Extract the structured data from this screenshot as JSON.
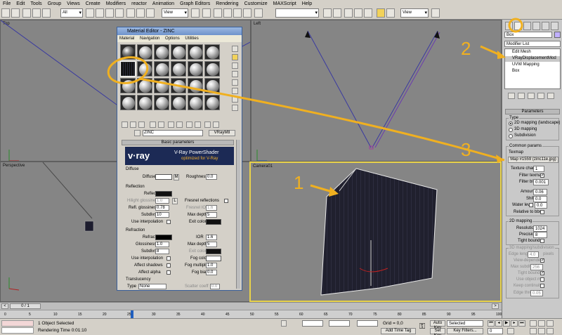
{
  "menu": [
    "File",
    "Edit",
    "Tools",
    "Group",
    "Views",
    "Create",
    "Modifiers",
    "reactor",
    "Animation",
    "Graph Editors",
    "Rendering",
    "Customize",
    "MAXScript",
    "Help"
  ],
  "toolbar": {
    "filter_value": "All",
    "ref_coord_value": "View",
    "selection_set_value": "",
    "view_value2": "View"
  },
  "viewports": {
    "top": "Top",
    "left": "Left",
    "perspective": "Perspective",
    "camera": "Camera01"
  },
  "material_editor": {
    "title": "Material Editor - ZINC",
    "menu": [
      "Material",
      "Navigation",
      "Options",
      "Utilities"
    ],
    "material_name": "ZINC",
    "material_type": "VRayMtl",
    "rollout_basic": "Basic parameters",
    "banner_title": "V-Ray PowerShader",
    "banner_subtitle": "optimized for V-Ray",
    "banner_logo": "v·ray",
    "diffuse_section": "Diffuse",
    "diffuse_label": "Diffuse",
    "diffuse_map_btn": "M",
    "roughness_label": "Roughness",
    "roughness_value": "0.0",
    "reflection_section": "Reflection",
    "reflect_label": "Reflect",
    "hilight_gloss_label": "Hilight glossiness",
    "hilight_gloss_value": "1.0",
    "hilight_lock": "L",
    "fresnel_label": "Fresnel reflections",
    "refl_gloss_label": "Refl. glossiness",
    "refl_gloss_value": "0.78",
    "fresnel_ior_label": "Fresnel IOR",
    "fresnel_ior_value": "1.6",
    "subdivs_label": "Subdivs",
    "subdivs_value": "10",
    "max_depth_label": "Max depth",
    "max_depth_value": "5",
    "use_interp_label": "Use interpolation",
    "exit_color_label": "Exit color",
    "refraction_section": "Refraction",
    "refract_label": "Refract",
    "ior_label": "IOR",
    "ior_value": "1.6",
    "refr_gloss_label": "Glossiness",
    "refr_gloss_value": "1.0",
    "refr_max_depth_label": "Max depth",
    "refr_max_depth_value": "5",
    "refr_subdivs_label": "Subdivs",
    "refr_subdivs_value": "8",
    "refr_exit_color_label": "Exit color",
    "refr_use_interp_label": "Use interpolation",
    "fog_color_label": "Fog color",
    "affect_shadows_label": "Affect shadows",
    "fog_mult_label": "Fog multiplier",
    "fog_mult_value": "1.0",
    "affect_alpha_label": "Affect alpha",
    "fog_bias_label": "Fog bias",
    "fog_bias_value": "0.0",
    "translucency_section": "Translucency",
    "type_label": "Type",
    "type_value": "None",
    "scatter_label": "Scatter coeff",
    "scatter_value": "0.0"
  },
  "command_panel": {
    "object_name": "Box",
    "modifier_list": "Modifier List",
    "stack": [
      "Edit Mesh",
      "VRayDisplacementMod",
      "UVW Mapping",
      "Box"
    ],
    "rollout_params": "Parameters",
    "type_group": "Type",
    "type_options": [
      "2D mapping (landscape)",
      "3D mapping",
      "Subdivision"
    ],
    "common_group": "Common params",
    "texmap_label": "Texmap",
    "texmap_value": "Map #1559 (zinc11e.jpg)",
    "texture_chan_label": "Texture chan",
    "texture_chan_value": "1",
    "filter_texmap_label": "Filter texmap",
    "filter_blur_label": "Filter blur",
    "filter_blur_value": "0.001",
    "amount_label": "Amount",
    "amount_value": "0.06",
    "shift_label": "Shift",
    "shift_value": "0.0",
    "water_level_label": "Water level",
    "water_level_value": "0.0",
    "relative_bbox_label": "Relative to bbox",
    "mapping2d_group": "2D mapping",
    "resolution_label": "Resolution",
    "resolution_value": "1024",
    "precision_label": "Precision",
    "precision_value": "8",
    "tight_bounds_label": "Tight bounds",
    "mapping3d_group": "3D mapping/subdivision",
    "edge_length_label": "Edge length",
    "edge_length_value": "4.0",
    "pixels_label": "pixels",
    "view_dependent_label": "View-dependent",
    "max_subdivs_label": "Max subdivs",
    "max_subdivs_value": "256",
    "tight_bounds2_label": "Tight bounds",
    "use_object_mtl_label": "Use object mtl",
    "keep_continuity_label": "Keep continuity",
    "edge_thresh_label": "Edge thresh",
    "edge_thresh_value": "0.05"
  },
  "timeline": {
    "frame_label": "0 / 1"
  },
  "ruler": [
    "0",
    "5",
    "10",
    "15",
    "20",
    "25",
    "30",
    "35",
    "40",
    "45",
    "50",
    "55",
    "60",
    "65",
    "70",
    "75",
    "80",
    "85",
    "90",
    "95",
    "100"
  ],
  "status": {
    "selected": "1 Object Selected",
    "render_time": "Rendering Time  0:01:10",
    "grid": "Grid = 0,0",
    "add_time_tag": "Add Time Tag",
    "auto_key": "Auto Key",
    "set_key": "Set Key",
    "selected_dropdown": "Selected",
    "key_filters": "Key Filters...",
    "frame_value": "0"
  },
  "annotations": [
    "1",
    "2",
    "3"
  ],
  "colors": {
    "annotation": "#f0b020",
    "active_viewport": "#e8d24a",
    "viewport_bg": "#858585"
  }
}
